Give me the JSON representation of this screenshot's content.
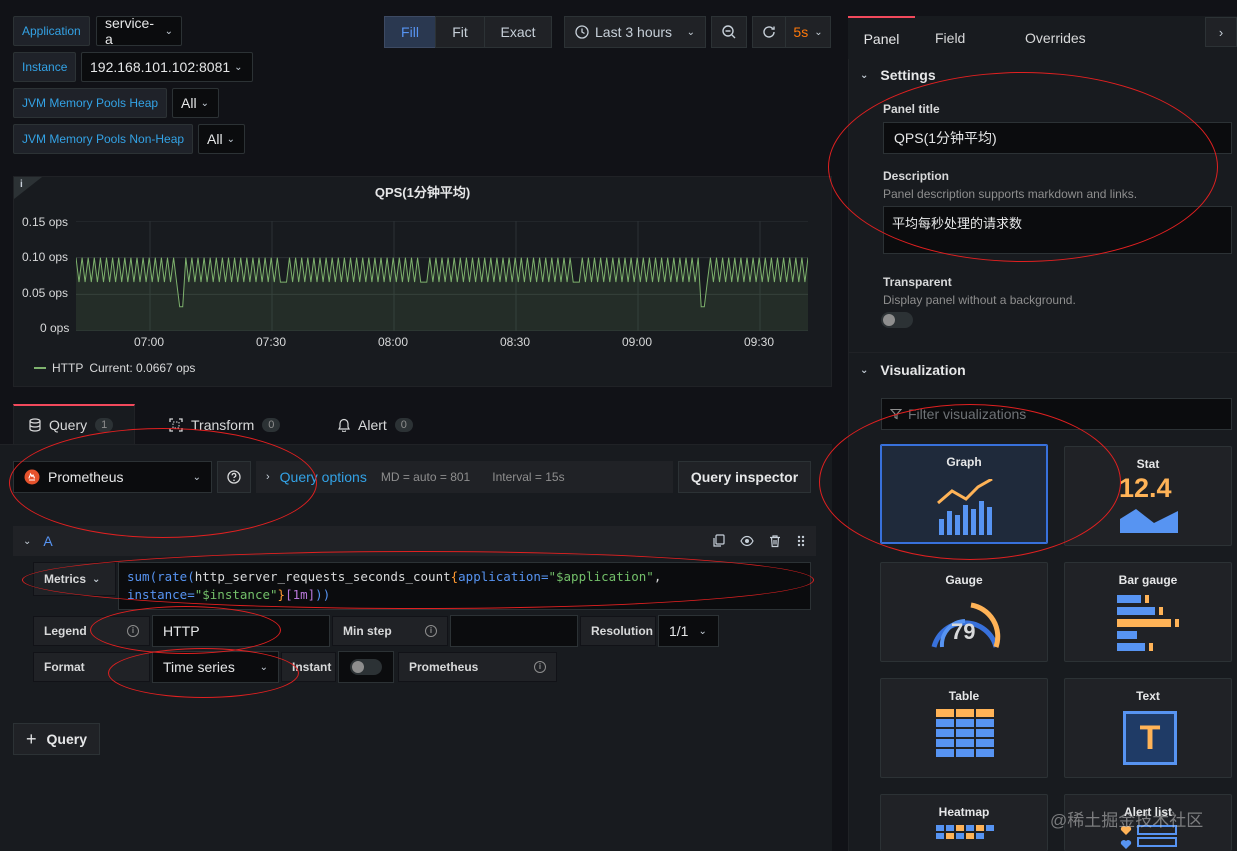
{
  "variables": [
    {
      "label": "Application",
      "value": "service-a"
    },
    {
      "label": "Instance",
      "value": "192.168.101.102:8081"
    },
    {
      "label": "JVM Memory Pools Heap",
      "value": "All"
    },
    {
      "label": "JVM Memory Pools Non-Heap",
      "value": "All"
    }
  ],
  "toolbar": {
    "fill": "Fill",
    "fit": "Fit",
    "exact": "Exact",
    "time_range": "Last 3 hours",
    "refresh_interval": "5s"
  },
  "graph": {
    "title": "QPS(1分钟平均)",
    "info_mark": "i",
    "y_ticks": [
      "0.15 ops",
      "0.10 ops",
      "0.05 ops",
      "0 ops"
    ],
    "x_ticks": [
      "07:00",
      "07:30",
      "08:00",
      "08:30",
      "09:00",
      "09:30"
    ],
    "legend_series": "HTTP",
    "legend_current": "Current: 0.0667 ops",
    "color": "#7eb26d"
  },
  "chart_data": {
    "type": "line",
    "series": [
      {
        "name": "HTTP",
        "baseline": 0.0667,
        "peak": 0.1
      }
    ],
    "ylim": [
      0,
      0.15
    ],
    "categories": [
      "07:00",
      "07:30",
      "08:00",
      "08:30",
      "09:00",
      "09:30"
    ],
    "grid": true,
    "legend_placement": "bottom-left"
  },
  "query_tabs": [
    {
      "label": "Query",
      "count": "1"
    },
    {
      "label": "Transform",
      "count": "0"
    },
    {
      "label": "Alert",
      "count": "0"
    }
  ],
  "datasource": {
    "name": "Prometheus",
    "query_options": "Query options",
    "md": "MD = auto = 801",
    "interval": "Interval = 15s",
    "inspector": "Query inspector"
  },
  "query_a": {
    "ref": "A",
    "metrics_label": "Metrics",
    "expr_line1_parts": [
      "sum(",
      "rate(",
      "http_server_requests_seconds_count",
      "{",
      "application=",
      "\"$application\"",
      ","
    ],
    "expr_line2_parts": [
      "instance=",
      "\"$instance\"",
      "}",
      "[1m]",
      "))"
    ],
    "legend_label": "Legend",
    "legend_value": "HTTP",
    "min_step_label": "Min step",
    "resolution_label": "Resolution",
    "resolution_value": "1/1",
    "format_label": "Format",
    "format_value": "Time series",
    "instant_label": "Instant",
    "prometheus_label": "Prometheus"
  },
  "add_query": "Query",
  "options_panel": {
    "tabs": [
      "Panel",
      "Field",
      "Overrides"
    ],
    "settings_header": "Settings",
    "panel_title_label": "Panel title",
    "panel_title_value": "QPS(1分钟平均)",
    "description_label": "Description",
    "description_hint": "Panel description supports markdown and links.",
    "description_value": "平均每秒处理的请求数",
    "transparent_label": "Transparent",
    "transparent_hint": "Display panel without a background.",
    "visualization_header": "Visualization",
    "filter_placeholder": "Filter visualizations",
    "viz": [
      "Graph",
      "Stat",
      "Gauge",
      "Bar gauge",
      "Table",
      "Text",
      "Heatmap",
      "Alert list"
    ],
    "stat_value": "12.4",
    "gauge_value": "79",
    "text_glyph": "T"
  },
  "watermark": "@稀土掘金技术社区"
}
